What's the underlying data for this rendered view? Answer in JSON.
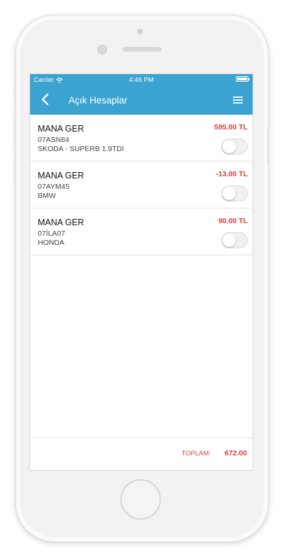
{
  "status_bar": {
    "carrier": "Carrier",
    "time": "4:46 PM"
  },
  "navbar": {
    "title": "Açık Hesaplar"
  },
  "accounts": [
    {
      "name": "MANA GER",
      "plate": "07ASN84",
      "vehicle": "SKODA - SUPERB 1.9TDI",
      "amount": "595.00 TL",
      "toggle_on": false
    },
    {
      "name": "MANA GER",
      "plate": "07AYM45",
      "vehicle": "BMW",
      "amount": "-13.00 TL",
      "toggle_on": false
    },
    {
      "name": "MANA GER",
      "plate": "07İLA07",
      "vehicle": "HONDA",
      "amount": "90.00 TL",
      "toggle_on": false
    }
  ],
  "footer": {
    "total_label": "TOPLAM:",
    "total_value": "672.00"
  },
  "colors": {
    "navbar": "#3ba3d0",
    "amount": "#e53935"
  }
}
